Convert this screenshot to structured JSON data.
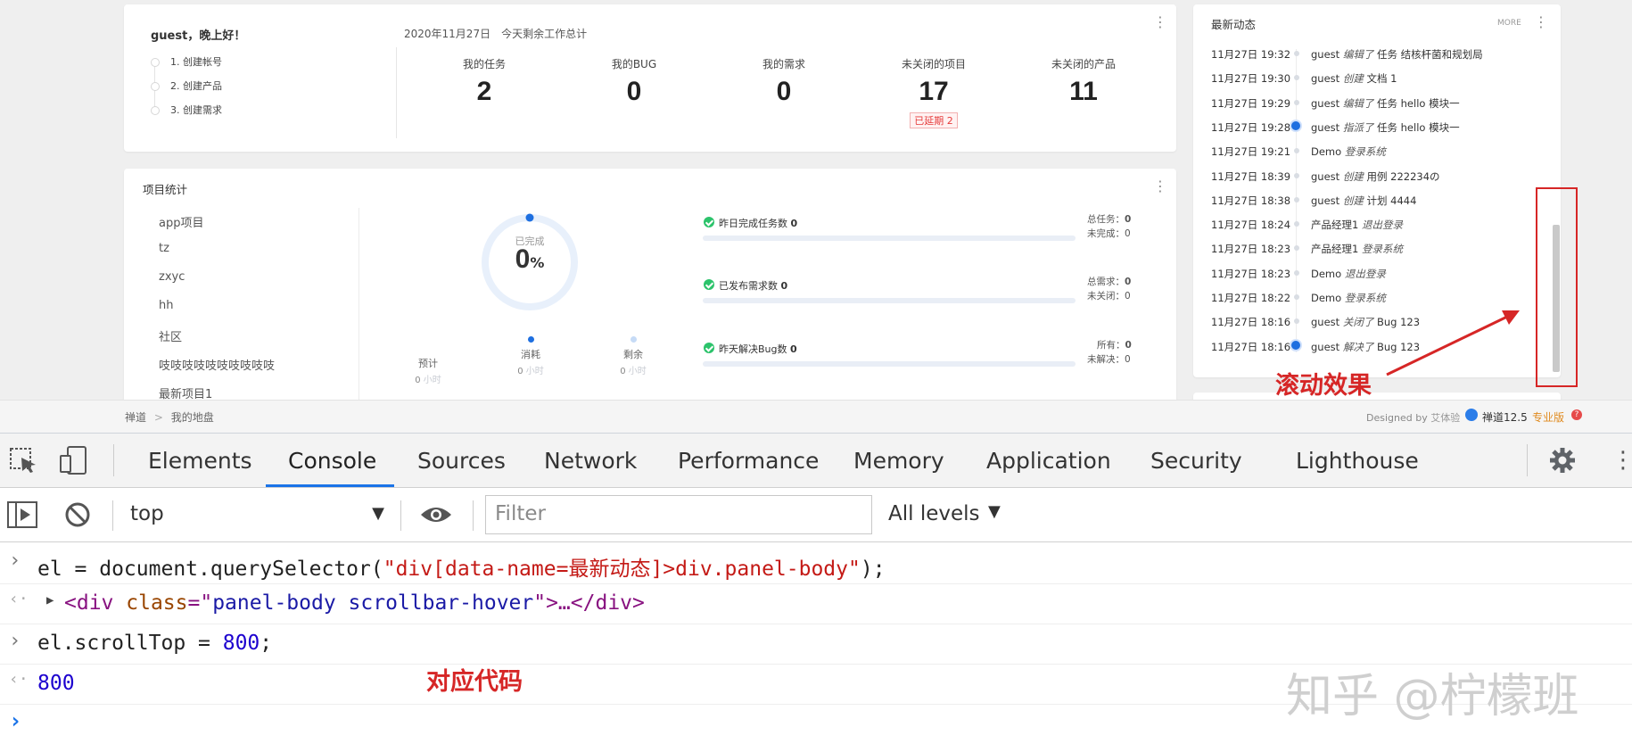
{
  "welcome_panel": {
    "greeting": "guest，晚上好！",
    "steps": [
      "1. 创建帐号",
      "2. 创建产品",
      "3. 创建需求"
    ],
    "date_line": "2020年11月27日　今天剩余工作总计",
    "stats": [
      {
        "label": "我的任务",
        "value": "2"
      },
      {
        "label": "我的BUG",
        "value": "0"
      },
      {
        "label": "我的需求",
        "value": "0"
      },
      {
        "label": "未关闭的项目",
        "value": "17",
        "badge": "已延期 2"
      },
      {
        "label": "未关闭的产品",
        "value": "11"
      }
    ]
  },
  "project_panel": {
    "title": "项目统计",
    "projects": [
      "app项目",
      "tz",
      "zxyc",
      "hh",
      "社区",
      "吱吱吱吱吱吱吱吱吱吱"
    ],
    "partial_project": "最新项目1",
    "donut": {
      "label": "已完成",
      "value": "0",
      "unit": "%",
      "percent": 0
    },
    "hours": [
      {
        "label": "预计",
        "value": "0",
        "unit": "小时"
      },
      {
        "label": "消耗",
        "value": "0",
        "unit": "小时"
      },
      {
        "label": "剩余",
        "value": "0",
        "unit": "小时"
      }
    ],
    "metrics": [
      {
        "label": "昨日完成任务数",
        "value": "0",
        "right1_label": "总任务：",
        "right1_value": "0",
        "right2_label": "未完成：",
        "right2_value": "0"
      },
      {
        "label": "已发布需求数",
        "value": "0",
        "right1_label": "总需求：",
        "right1_value": "0",
        "right2_label": "未关闭：",
        "right2_value": "0"
      },
      {
        "label": "昨天解决Bug数",
        "value": "0",
        "right1_label": "所有：",
        "right1_value": "0",
        "right2_label": "未解决：",
        "right2_value": "0"
      }
    ]
  },
  "activity_panel": {
    "title": "最新动态",
    "more": "MORE",
    "items": [
      {
        "time": "11月27日 19:32",
        "user": "guest",
        "action": "编辑了",
        "target": "任务 结核杆菌和规划局",
        "highlight": false
      },
      {
        "time": "11月27日 19:30",
        "user": "guest",
        "action": "创建",
        "target": "文档 1",
        "highlight": false
      },
      {
        "time": "11月27日 19:29",
        "user": "guest",
        "action": "编辑了",
        "target": "任务 hello 模块一",
        "highlight": false
      },
      {
        "time": "11月27日 19:28",
        "user": "guest",
        "action": "指派了",
        "target": "任务 hello 模块一",
        "highlight": true
      },
      {
        "time": "11月27日 19:21",
        "user": "Demo",
        "action": "登录系统",
        "target": "",
        "highlight": false
      },
      {
        "time": "11月27日 18:39",
        "user": "guest",
        "action": "创建",
        "target": "用例 222234の",
        "highlight": false
      },
      {
        "time": "11月27日 18:38",
        "user": "guest",
        "action": "创建",
        "target": "计划 4444",
        "highlight": false
      },
      {
        "time": "11月27日 18:24",
        "user": "产品经理1",
        "action": "退出登录",
        "target": "",
        "highlight": false
      },
      {
        "time": "11月27日 18:23",
        "user": "产品经理1",
        "action": "登录系统",
        "target": "",
        "highlight": false
      },
      {
        "time": "11月27日 18:23",
        "user": "Demo",
        "action": "退出登录",
        "target": "",
        "highlight": false
      },
      {
        "time": "11月27日 18:22",
        "user": "Demo",
        "action": "登录系统",
        "target": "",
        "highlight": false
      },
      {
        "time": "11月27日 18:16",
        "user": "guest",
        "action": "关闭了",
        "target": "Bug 123",
        "highlight": false
      },
      {
        "time": "11月27日 18:16",
        "user": "guest",
        "action": "解决了",
        "target": "Bug 123",
        "highlight": true
      }
    ]
  },
  "footer": {
    "breadcrumb_root": "禅道",
    "breadcrumb_sep": ">",
    "breadcrumb_current": "我的地盘",
    "designed_by": "Designed by",
    "designer": "艾体验",
    "version": "禅道12.5",
    "edition": "专业版"
  },
  "devtools": {
    "tabs": [
      "Elements",
      "Console",
      "Sources",
      "Network",
      "Performance",
      "Memory",
      "Application",
      "Security",
      "Lighthouse"
    ],
    "active_tab": "Console",
    "context": "top",
    "filter_placeholder": "Filter",
    "levels": "All levels",
    "console": {
      "line1_pre": "el = document.querySelector(",
      "line1_str": "\"div[data-name=最新动态]>div.panel-body\"",
      "line1_post": ");",
      "line2_tag_open": "<div",
      "line2_attr": "class",
      "line2_eq": "=\"",
      "line2_val": "panel-body scrollbar-hover",
      "line2_rest": "\">…",
      "line2_tag_close": "</div>",
      "line3_pre": "el.scrollTop = ",
      "line3_num": "800",
      "line3_post": ";",
      "line4_result": "800"
    }
  },
  "annotations": {
    "scroll_effect": "滚动效果",
    "code_label": "对应代码",
    "color": "#d62626"
  },
  "watermark": "知乎 @柠檬班"
}
